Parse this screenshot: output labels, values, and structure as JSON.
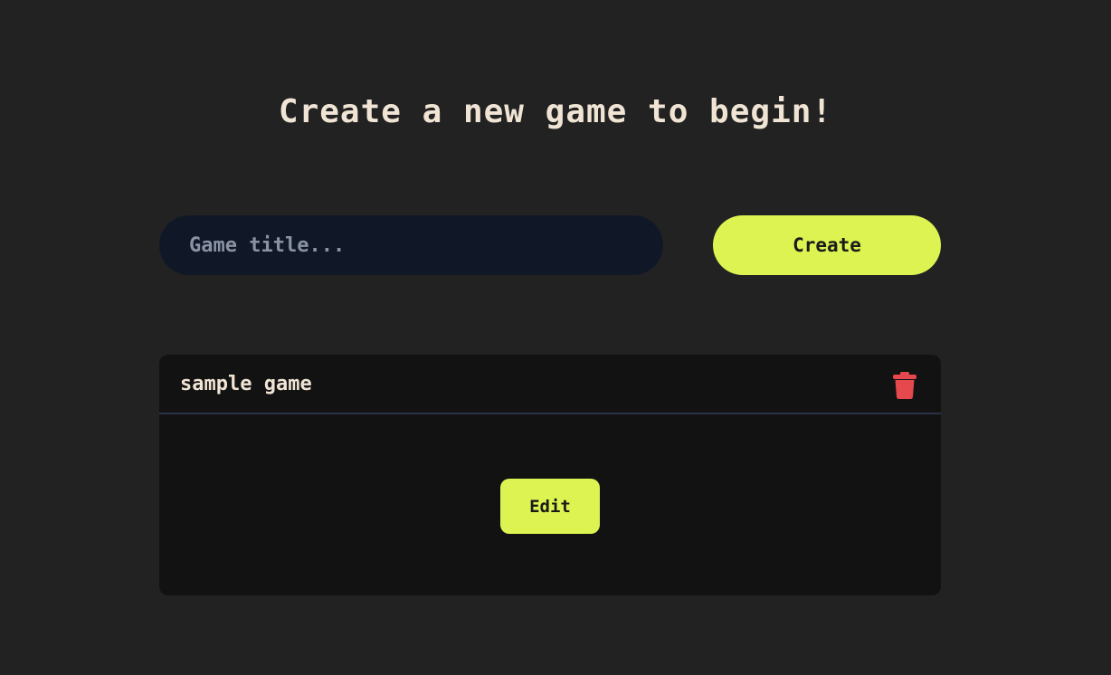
{
  "header": {
    "title": "Create a new game to begin!"
  },
  "create_form": {
    "input_placeholder": "Game title...",
    "input_value": "",
    "create_label": "Create"
  },
  "games": [
    {
      "name": "sample game",
      "edit_label": "Edit",
      "delete_icon": "trash-icon"
    }
  ],
  "colors": {
    "background": "#222222",
    "accent": "#dcf352",
    "input_background": "#101828",
    "card_background": "#121212",
    "delete": "#e5484d",
    "text": "#f0e4d4"
  }
}
